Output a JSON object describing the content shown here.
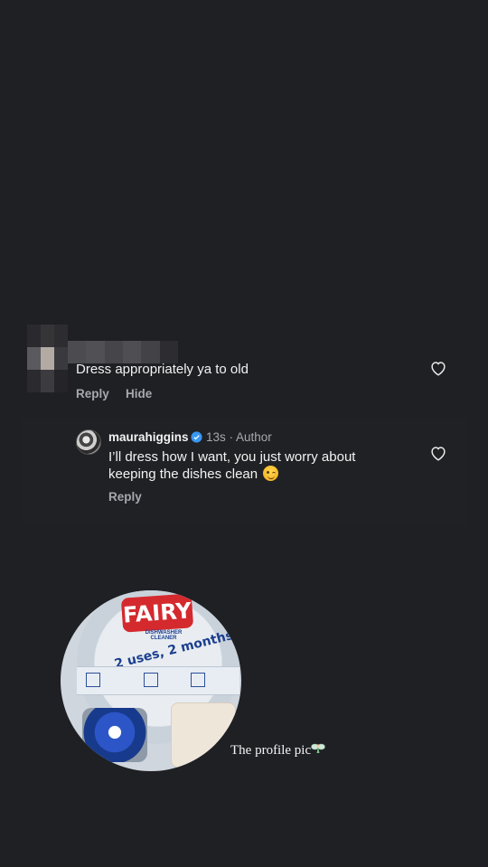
{
  "comment": {
    "text": "Dress appropriately ya to old",
    "actions": {
      "reply": "Reply",
      "hide": "Hide"
    }
  },
  "reply": {
    "username": "maurahiggins",
    "verified": true,
    "meta": "13s · Author",
    "text": "I’ll dress how I want, you just worry about keeping the dishes clean",
    "emoji": "winking-face",
    "actions": {
      "reply": "Reply"
    }
  },
  "profile_pic": {
    "brand": "FAIRY",
    "product_line": "DISHWASHER CLEANER",
    "tagline": "2 uses, 2 months"
  },
  "caption": {
    "text": "The profile pic",
    "emoji": "fairy"
  },
  "colors": {
    "background": "#1f2024",
    "secondary_text": "#a7a8ad",
    "verified_blue": "#3897f0"
  }
}
